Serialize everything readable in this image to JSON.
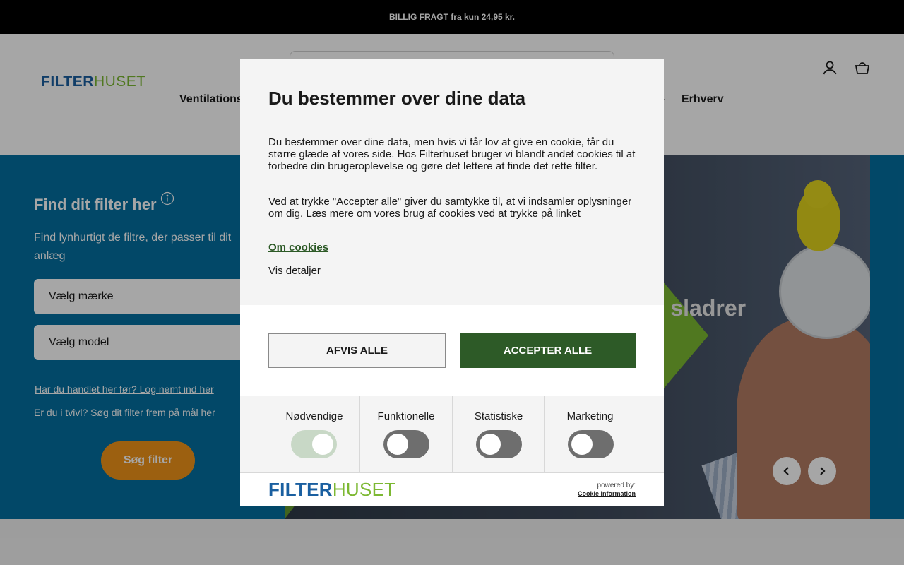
{
  "announcement": {
    "text": "BILLIG FRAGT fra kun 24,95 kr."
  },
  "header": {
    "logo_part1": "FILTER",
    "logo_part2": "HUSET",
    "nav": {
      "ventilation": "Ventilations",
      "erhverv": "Erhverv"
    },
    "icons": {
      "account": "account-icon",
      "cart": "cart-icon",
      "chevron": "chevron-down-icon"
    }
  },
  "hero": {
    "finder_title": "Find dit filter her",
    "finder_subtitle": "Find lynhurtigt de filtre, der passer til dit anlæg",
    "select_brand": "Vælg mærke",
    "select_model": "Vælg model",
    "link_login": "Har du handlet her før? Log nemt ind her",
    "link_measure": "Er du i tvivl? Søg dit filter frem på mål her",
    "search_button": "Søg filter",
    "headline_fragment": "r sladrer"
  },
  "cookie": {
    "title": "Du bestemmer over dine data",
    "text1": "Du bestemmer over dine data, men hvis vi får lov at give en cookie, får du større glæde af vores side. Hos Filterhuset bruger vi blandt andet cookies til at forbedre din brugeroplevelse og gøre det lettere at finde det rette filter.",
    "text2": "Ved at trykke \"Accepter alle\" giver du samtykke til, at vi indsamler oplysninger om dig. Læs mere om vores brug af cookies ved at trykke på linket",
    "link_about": "Om cookies",
    "link_details": "Vis detaljer",
    "decline_button": "AFVIS ALLE",
    "accept_button": "ACCEPTER ALLE",
    "categories": [
      {
        "label": "Nødvendige",
        "enabled": true
      },
      {
        "label": "Funktionelle",
        "enabled": false
      },
      {
        "label": "Statistiske",
        "enabled": false
      },
      {
        "label": "Marketing",
        "enabled": false
      }
    ],
    "footer_logo_part1": "FILTER",
    "footer_logo_part2": "HUSET",
    "powered_by": "powered by:",
    "provider": "Cookie Information"
  },
  "colors": {
    "brand_blue": "#1a5fa0",
    "brand_green": "#7cb832",
    "accept_green": "#2d5a27",
    "hero_blue": "#046fa0",
    "cta_orange": "#f0941a"
  }
}
